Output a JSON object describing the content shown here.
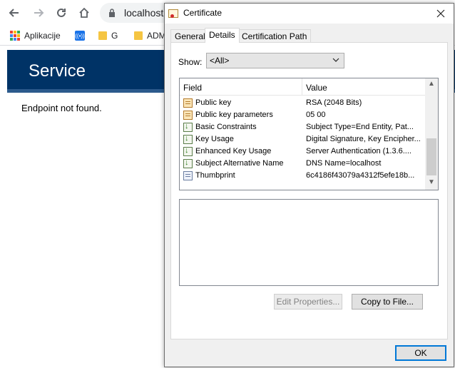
{
  "browser": {
    "url": "localhost",
    "bookmarks": [
      {
        "label": "Aplikacije",
        "icon": "apps-grid-icon"
      },
      {
        "label": "",
        "icon": "radio-icon"
      },
      {
        "label": "G",
        "icon": "folder-icon"
      },
      {
        "label": "ADM",
        "icon": "folder-icon"
      }
    ]
  },
  "page": {
    "title": "Service",
    "message": "Endpoint not found."
  },
  "dialog": {
    "title": "Certificate",
    "tabs": [
      "General",
      "Details",
      "Certification Path"
    ],
    "active_tab": "Details",
    "show_label": "Show:",
    "show_value": "<All>",
    "columns": {
      "field": "Field",
      "value": "Value"
    },
    "rows": [
      {
        "icon": "document-icon",
        "field": "Public key",
        "value": "RSA (2048 Bits)"
      },
      {
        "icon": "document-icon",
        "field": "Public key parameters",
        "value": "05 00"
      },
      {
        "icon": "extension-icon",
        "field": "Basic Constraints",
        "value": "Subject Type=End Entity, Pat..."
      },
      {
        "icon": "extension-icon",
        "field": "Key Usage",
        "value": "Digital Signature, Key Encipher..."
      },
      {
        "icon": "extension-icon",
        "field": "Enhanced Key Usage",
        "value": "Server Authentication (1.3.6...."
      },
      {
        "icon": "extension-icon",
        "field": "Subject Alternative Name",
        "value": "DNS Name=localhost"
      },
      {
        "icon": "thumbprint-icon",
        "field": "Thumbprint",
        "value": "6c4186f43079a4312f5efe18b..."
      }
    ],
    "buttons": {
      "edit_properties": "Edit Properties...",
      "copy_to_file": "Copy to File...",
      "ok": "OK"
    }
  },
  "colors": {
    "banner": "#003366",
    "banner_stripe": "#2c5a8c",
    "focus_blue": "#0078d7"
  }
}
